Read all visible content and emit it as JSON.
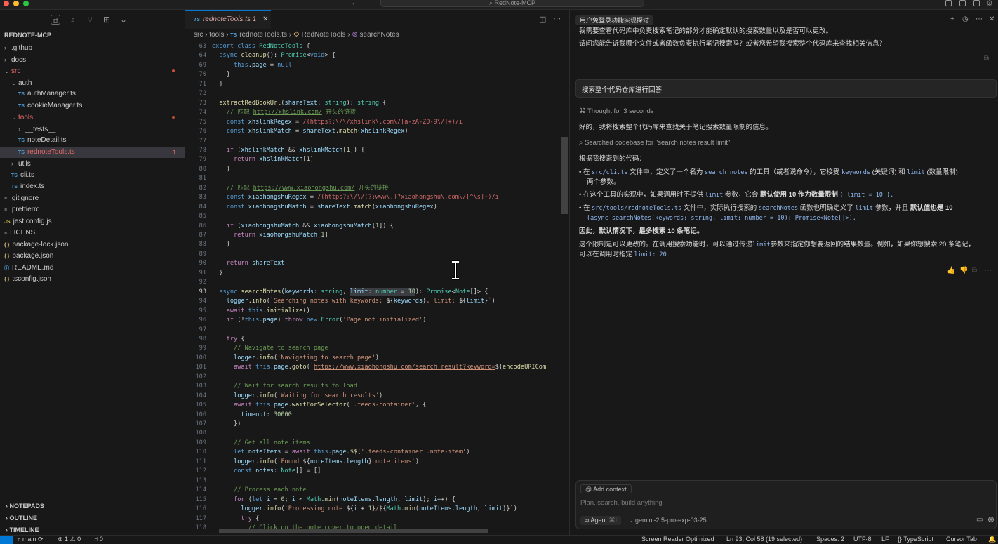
{
  "window": {
    "title": "RedNote-MCP"
  },
  "sidebar": {
    "root": "REDNOTE-MCP",
    "tree": [
      {
        "label": ".github",
        "kind": "folder",
        "open": false,
        "indent": 0
      },
      {
        "label": "docs",
        "kind": "folder",
        "open": false,
        "indent": 0
      },
      {
        "label": "src",
        "kind": "folder",
        "open": true,
        "indent": 0,
        "red": true,
        "modified": true
      },
      {
        "label": "auth",
        "kind": "folder",
        "open": true,
        "indent": 1
      },
      {
        "label": "authManager.ts",
        "kind": "ts",
        "indent": 2
      },
      {
        "label": "cookieManager.ts",
        "kind": "ts",
        "indent": 2
      },
      {
        "label": "tools",
        "kind": "folder",
        "open": true,
        "indent": 1,
        "red": true,
        "modified": true
      },
      {
        "label": "__tests__",
        "kind": "folder",
        "open": false,
        "indent": 2
      },
      {
        "label": "noteDetail.ts",
        "kind": "ts",
        "indent": 2
      },
      {
        "label": "rednoteTools.ts",
        "kind": "ts",
        "indent": 2,
        "red": true,
        "selected": true,
        "badge": "1"
      },
      {
        "label": "utils",
        "kind": "folder",
        "open": false,
        "indent": 1
      },
      {
        "label": "cli.ts",
        "kind": "ts",
        "indent": 1
      },
      {
        "label": "index.ts",
        "kind": "ts",
        "indent": 1
      },
      {
        "label": ".gitignore",
        "kind": "file",
        "indent": 0
      },
      {
        "label": ".prettierrc",
        "kind": "file",
        "indent": 0
      },
      {
        "label": "jest.config.js",
        "kind": "js",
        "indent": 0
      },
      {
        "label": "LICENSE",
        "kind": "file",
        "indent": 0
      },
      {
        "label": "package-lock.json",
        "kind": "json",
        "indent": 0
      },
      {
        "label": "package.json",
        "kind": "json",
        "indent": 0
      },
      {
        "label": "README.md",
        "kind": "md",
        "indent": 0
      },
      {
        "label": "tsconfig.json",
        "kind": "json",
        "indent": 0
      }
    ],
    "panels": [
      "NOTEPADS",
      "OUTLINE",
      "TIMELINE"
    ]
  },
  "editor": {
    "tab": "rednoteTools.ts",
    "tab_badge": "1",
    "breadcrumb": [
      "src",
      "tools",
      "rednoteTools.ts",
      "RedNoteTools",
      "searchNotes"
    ],
    "lines": [
      {
        "n": "63",
        "h": "<span class='k'>export class</span> <span class='t'>RedNoteTools</span> {"
      },
      {
        "n": "64",
        "h": "  <span class='k'>async</span> <span class='f'>cleanup</span>(): <span class='t'>Promise</span>&lt;<span class='k'>void</span>&gt; {"
      },
      {
        "n": "69",
        "h": "      <span class='k'>this</span>.<span class='v'>page</span> = <span class='k'>null</span>"
      },
      {
        "n": "70",
        "h": "    }"
      },
      {
        "n": "71",
        "h": "  }"
      },
      {
        "n": "72",
        "h": ""
      },
      {
        "n": "73",
        "h": "  <span class='f'>extractRedBookUrl</span>(<span class='v'>shareText</span>: <span class='t'>string</span>): <span class='t'>string</span> {"
      },
      {
        "n": "74",
        "h": "    <span class='c'>// 匹配 <span class='u'>http://xhslink.com/</span> 开头的链接</span>"
      },
      {
        "n": "75",
        "h": "    <span class='k'>const</span> <span class='v'>xhslinkRegex</span> = <span class='r'>/(https?:\\/\\/xhslink\\.com\\/[a-zA-Z0-9\\/]+)/i</span>"
      },
      {
        "n": "76",
        "h": "    <span class='k'>const</span> <span class='v'>xhslinkMatch</span> = <span class='v'>shareText</span>.<span class='f'>match</span>(<span class='v'>xhslinkRegex</span>)"
      },
      {
        "n": "77",
        "h": ""
      },
      {
        "n": "78",
        "h": "    <span class='p'>if</span> (<span class='v'>xhslinkMatch</span> &amp;&amp; <span class='v'>xhslinkMatch</span>[<span class='n'>1</span>]) {"
      },
      {
        "n": "79",
        "h": "      <span class='p'>return</span> <span class='v'>xhslinkMatch</span>[<span class='n'>1</span>]"
      },
      {
        "n": "80",
        "h": "    }"
      },
      {
        "n": "81",
        "h": ""
      },
      {
        "n": "82",
        "h": "    <span class='c'>// 匹配 <span class='u'>https://www.xiaohongshu.com/</span> 开头的链接</span>"
      },
      {
        "n": "83",
        "h": "    <span class='k'>const</span> <span class='v'>xiaohongshuRegex</span> = <span class='r'>/(https?:\\/\\/(?:www\\.)?xiaohongshu\\.com\\/[^\\s]+)/i</span>"
      },
      {
        "n": "84",
        "h": "    <span class='k'>const</span> <span class='v'>xiaohongshuMatch</span> = <span class='v'>shareText</span>.<span class='f'>match</span>(<span class='v'>xiaohongshuRegex</span>)"
      },
      {
        "n": "85",
        "h": ""
      },
      {
        "n": "86",
        "h": "    <span class='p'>if</span> (<span class='v'>xiaohongshuMatch</span> &amp;&amp; <span class='v'>xiaohongshuMatch</span>[<span class='n'>1</span>]) {"
      },
      {
        "n": "87",
        "h": "      <span class='p'>return</span> <span class='v'>xiaohongshuMatch</span>[<span class='n'>1</span>]"
      },
      {
        "n": "88",
        "h": "    }"
      },
      {
        "n": "89",
        "h": ""
      },
      {
        "n": "90",
        "h": "    <span class='p'>return</span> <span class='v'>shareText</span>"
      },
      {
        "n": "91",
        "h": "  }"
      },
      {
        "n": "92",
        "h": ""
      },
      {
        "n": "93",
        "h": "  <span class='k'>async</span> <span class='f'>searchNotes</span>(<span class='v'>keywords</span>: <span class='t'>string</span>, <span class='hl'><span class='v'>limit</span>: <span class='t'>number</span> = <span class='n'>10</span></span>): <span class='t'>Promise</span>&lt;<span class='t'>Note</span>[]&gt; {",
        "cur": true
      },
      {
        "n": "94",
        "h": "    <span class='v'>logger</span>.<span class='f'>info</span>(<span class='s'>`Searching notes with keywords: </span>${<span class='v'>keywords</span>}<span class='s'>, limit: </span>${<span class='v'>limit</span>}<span class='s'>`</span>)"
      },
      {
        "n": "95",
        "h": "    <span class='p'>await</span> <span class='k'>this</span>.<span class='f'>initialize</span>()"
      },
      {
        "n": "96",
        "h": "    <span class='p'>if</span> (!<span class='k'>this</span>.<span class='v'>page</span>) <span class='p'>throw</span> <span class='k'>new</span> <span class='t'>Error</span>(<span class='s'>'Page not initialized'</span>)"
      },
      {
        "n": "97",
        "h": ""
      },
      {
        "n": "98",
        "h": "    <span class='p'>try</span> {"
      },
      {
        "n": "99",
        "h": "      <span class='c'>// Navigate to search page</span>"
      },
      {
        "n": "100",
        "h": "      <span class='v'>logger</span>.<span class='f'>info</span>(<span class='s'>'Navigating to search page'</span>)"
      },
      {
        "n": "101",
        "h": "      <span class='p'>await</span> <span class='k'>this</span>.<span class='v'>page</span>.<span class='f'>goto</span>(<span class='s'>`<span class='u'>https://www.xiaohongshu.com/search_result?keyword=</span></span>${<span class='f'>encodeURICom</span>"
      },
      {
        "n": "102",
        "h": ""
      },
      {
        "n": "103",
        "h": "      <span class='c'>// Wait for search results to load</span>"
      },
      {
        "n": "104",
        "h": "      <span class='v'>logger</span>.<span class='f'>info</span>(<span class='s'>'Waiting for search results'</span>)"
      },
      {
        "n": "105",
        "h": "      <span class='p'>await</span> <span class='k'>this</span>.<span class='v'>page</span>.<span class='f'>waitForSelector</span>(<span class='s'>'.feeds-container'</span>, {"
      },
      {
        "n": "106",
        "h": "        <span class='v'>timeout</span>: <span class='n'>30000</span>"
      },
      {
        "n": "107",
        "h": "      })"
      },
      {
        "n": "108",
        "h": ""
      },
      {
        "n": "109",
        "h": "      <span class='c'>// Get all note items</span>"
      },
      {
        "n": "110",
        "h": "      <span class='k'>let</span> <span class='v'>noteItems</span> = <span class='p'>await</span> <span class='k'>this</span>.<span class='v'>page</span>.<span class='f'>$$</span>(<span class='s'>'.feeds-container .note-item'</span>)"
      },
      {
        "n": "111",
        "h": "      <span class='v'>logger</span>.<span class='f'>info</span>(<span class='s'>`Found </span>${<span class='v'>noteItems</span>.<span class='v'>length</span>}<span class='s'> note items`</span>)"
      },
      {
        "n": "112",
        "h": "      <span class='k'>const</span> <span class='v'>notes</span>: <span class='t'>Note</span>[] = []"
      },
      {
        "n": "113",
        "h": ""
      },
      {
        "n": "114",
        "h": "      <span class='c'>// Process each note</span>"
      },
      {
        "n": "115",
        "h": "      <span class='p'>for</span> (<span class='k'>let</span> <span class='v'>i</span> = <span class='n'>0</span>; <span class='v'>i</span> &lt; <span class='t'>Math</span>.<span class='f'>min</span>(<span class='v'>noteItems</span>.<span class='v'>length</span>, <span class='v'>limit</span>); <span class='v'>i</span>++) {"
      },
      {
        "n": "116",
        "h": "        <span class='v'>logger</span>.<span class='f'>info</span>(<span class='s'>`Processing note </span>${<span class='v'>i</span> + <span class='n'>1</span>}<span class='s'>/</span>${<span class='t'>Math</span>.<span class='f'>min</span>(<span class='v'>noteItems</span>.<span class='v'>length</span>, <span class='v'>limit</span>)}<span class='s'>`</span>)"
      },
      {
        "n": "117",
        "h": "        <span class='p'>try</span> {"
      },
      {
        "n": "118",
        "h": "          <span class='c'>// Click on the note cover to open detail</span>"
      }
    ]
  },
  "chat": {
    "tab_title": "用户免登录功能实现探讨",
    "intro1": "我需要查看代码库中负责搜索笔记的部分才能确定默认的搜索数量以及是否可以更改。",
    "intro2": "请问您能告诉我哪个文件或者函数负责执行笔记搜索吗？或者您希望我搜索整个代码库来查找相关信息？",
    "user_msg": "搜索整个代码仓库进行回答",
    "thought": "Thought for 3 seconds",
    "reply1": "好的，我将搜索整个代码库来查找关于笔记搜索数量限制的信息。",
    "searched": "Searched codebase for \"search notes result limit\"",
    "found_heading": "根据我搜索到的代码：",
    "b1a": "在",
    "b1_code": "src/cli.ts",
    "b1b": "文件中，定义了一个名为",
    "b1_code2": "search_notes",
    "b1c": "的工具（或者说命令），它接受",
    "b1_code3": "keywords",
    "b1d": "(关键词) 和",
    "b1_code4": "limit",
    "b1e": "(数量限制)",
    "b1f": "两个参数。",
    "b2a": "在这个工具的实现中，如果调用时不提供",
    "b2_code": "limit",
    "b2b": "参数，它会",
    "b2c": "默认使用 10 作为数量限制",
    "b2_code2": "( limit = 10 ).",
    "b3a": "在",
    "b3_code": "src/tools/rednoteTools.ts",
    "b3b": "文件中，实际执行搜索的",
    "b3_code2": "searchNotes",
    "b3c": "函数也明确定义了",
    "b3_code3": "limit",
    "b3d": "参数，并且",
    "b3e": "默认值也是 10",
    "b3_code4": "(async searchNotes(keywords: string, limit: number = 10): Promise<Note[]>).",
    "conclusion": "因此，默认情况下，最多搜索 10 条笔记。",
    "p_a": "这个限制是可以更改的。在调用搜索功能时，可以通过传递",
    "p_code": "limit",
    "p_b": "参数来指定你想要返回的结果数量。例如，如果你想搜索 20 条笔记，",
    "p_c": "可以在调用时指定",
    "p_code2": "limit: 20",
    "input": {
      "add_context": "Add context",
      "placeholder": "Plan, search, build anything",
      "mode": "Agent",
      "mode_shortcut": "⌘I",
      "model": "gemini-2.5-pro-exp-03-25"
    }
  },
  "status": {
    "branch": "main",
    "errors": "1",
    "warnings": "0",
    "ports": "0",
    "screen_reader": "Screen Reader Optimized",
    "position": "Ln 93, Col 58 (19 selected)",
    "spaces": "Spaces: 2",
    "encoding": "UTF-8",
    "eol": "LF",
    "language": "TypeScript",
    "cursor_tab": "Cursor Tab"
  },
  "colors": {
    "accent": "#0078d4",
    "error": "#e56a6a",
    "keyword": "#569cd6",
    "string": "#ce9178"
  }
}
